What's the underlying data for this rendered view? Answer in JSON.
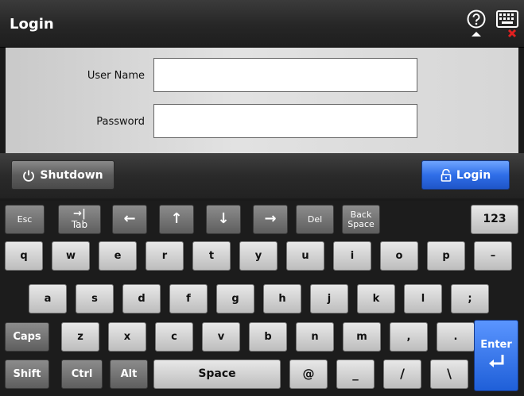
{
  "header": {
    "title": "Login",
    "help_icon": "question-circle-icon",
    "keyboard_icon": "keyboard-close-icon"
  },
  "form": {
    "username_label": "User Name",
    "username_value": "",
    "password_label": "Password",
    "password_value": ""
  },
  "actions": {
    "shutdown_label": "Shutdown",
    "login_label": "Login"
  },
  "keyboard": {
    "esc": "Esc",
    "tab_arrow": "→|",
    "tab": "Tab",
    "left": "←",
    "up": "↑",
    "down": "↓",
    "right": "→",
    "del": "Del",
    "back_line1": "Back",
    "back_line2": "Space",
    "mode": "123",
    "row2": [
      "q",
      "w",
      "e",
      "r",
      "t",
      "y",
      "u",
      "i",
      "o",
      "p",
      "–"
    ],
    "row3": [
      "a",
      "s",
      "d",
      "f",
      "g",
      "h",
      "j",
      "k",
      "l",
      ";"
    ],
    "caps": "Caps",
    "row4": [
      "z",
      "x",
      "c",
      "v",
      "b",
      "n",
      "m",
      ",",
      "."
    ],
    "enter": "Enter",
    "shift": "Shift",
    "ctrl": "Ctrl",
    "alt": "Alt",
    "space": "Space",
    "row5": [
      "@",
      "_",
      "/",
      "\\"
    ]
  },
  "colors": {
    "accent": "#2f6ee8",
    "close_mark": "#e02020"
  }
}
